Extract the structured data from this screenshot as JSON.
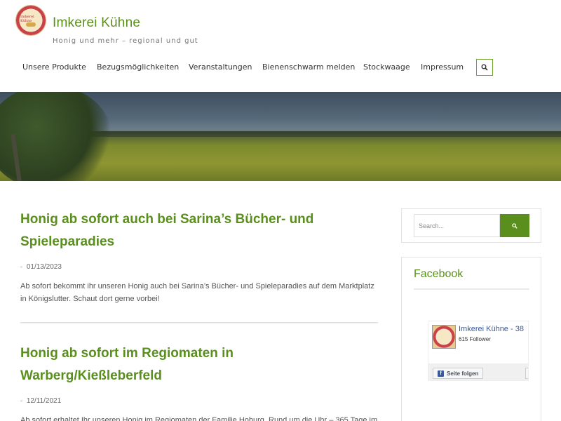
{
  "header": {
    "logo_text": "Imkerei Kühne",
    "title": "Imkerei Kühne",
    "tagline": "Honig und mehr – regional und gut"
  },
  "nav": {
    "items": [
      {
        "label": "Unsere Produkte"
      },
      {
        "label": "Bezugsmöglichkeiten"
      },
      {
        "label": "Veranstaltungen"
      },
      {
        "label": "Bienenschwarm melden"
      },
      {
        "label": "Stockwaage"
      },
      {
        "label": "Impressum"
      }
    ],
    "search_icon": "search-icon"
  },
  "posts": [
    {
      "title": "Honig ab sofort auch bei Sarina’s Bücher- und Spieleparadies",
      "date": "01/13/2023",
      "excerpt": "Ab sofort bekommt ihr unseren Honig auch bei Sarina’s Bücher- und Spieleparadies auf dem Marktplatz in Königslutter. Schaut dort gerne vorbei!"
    },
    {
      "title": "Honig ab sofort im Regiomaten in Warberg/Kießleberfeld",
      "date": "12/11/2021",
      "excerpt": "Ab sofort erhaltet Ihr unseren Honig im Regiomaten der Familie Hoburg. Rund um die Uhr – 365 Tage im"
    }
  ],
  "sidebar": {
    "search_placeholder": "Search...",
    "facebook": {
      "heading": "Facebook",
      "page_name": "Imkerei Kühne - 38",
      "followers": "615 Follower",
      "follow_label": "Seite folgen"
    }
  },
  "colors": {
    "accent": "#5a8f1e",
    "facebook_blue": "#3b5998"
  }
}
